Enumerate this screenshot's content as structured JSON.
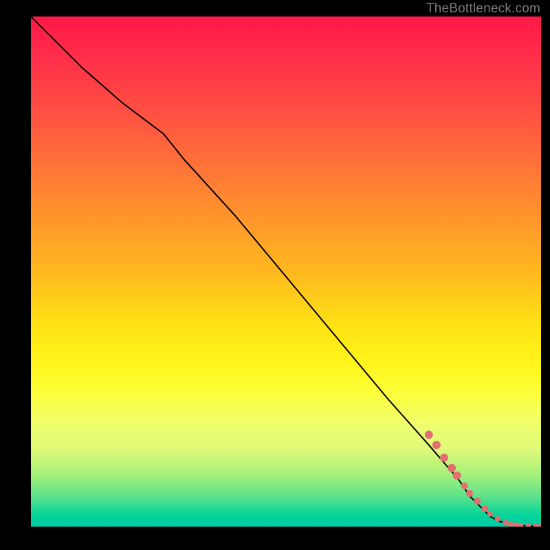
{
  "watermark": "TheBottleneck.com",
  "chart_data": {
    "type": "line",
    "title": "",
    "xlabel": "",
    "ylabel": "",
    "xlim": [
      0,
      100
    ],
    "ylim": [
      0,
      100
    ],
    "gradient_stops": [
      {
        "pos": 0,
        "color": "#ff1846"
      },
      {
        "pos": 8,
        "color": "#ff2e4a"
      },
      {
        "pos": 22,
        "color": "#ff5a3f"
      },
      {
        "pos": 36,
        "color": "#ff8a30"
      },
      {
        "pos": 50,
        "color": "#ffb81f"
      },
      {
        "pos": 60,
        "color": "#ffe015"
      },
      {
        "pos": 68,
        "color": "#fff51a"
      },
      {
        "pos": 74,
        "color": "#fbff3b"
      },
      {
        "pos": 80,
        "color": "#f0ff6e"
      },
      {
        "pos": 85,
        "color": "#def97a"
      },
      {
        "pos": 90,
        "color": "#a3f07a"
      },
      {
        "pos": 94,
        "color": "#5fe28c"
      },
      {
        "pos": 98,
        "color": "#00d49a"
      },
      {
        "pos": 100,
        "color": "#00c9a8"
      }
    ],
    "series": [
      {
        "name": "curve",
        "stroke": "#000000",
        "x": [
          0,
          10,
          18,
          26,
          30,
          40,
          50,
          60,
          70,
          78,
          84,
          86,
          88,
          90,
          92,
          94,
          96,
          98,
          100
        ],
        "y": [
          100,
          90,
          83,
          77,
          72,
          61,
          49,
          37,
          25,
          16,
          9,
          6,
          4,
          2,
          1,
          0.5,
          0.2,
          0.1,
          0.1
        ]
      }
    ],
    "markers": {
      "color": "#e27070",
      "points": [
        {
          "x": 78,
          "y": 18,
          "r": 6
        },
        {
          "x": 79.5,
          "y": 16,
          "r": 6
        },
        {
          "x": 81,
          "y": 13.5,
          "r": 6
        },
        {
          "x": 82.5,
          "y": 11.5,
          "r": 6
        },
        {
          "x": 83.5,
          "y": 10,
          "r": 6
        },
        {
          "x": 85,
          "y": 8,
          "r": 5
        },
        {
          "x": 86,
          "y": 6.5,
          "r": 5
        },
        {
          "x": 87.5,
          "y": 5,
          "r": 5
        },
        {
          "x": 89,
          "y": 3.5,
          "r": 5
        },
        {
          "x": 90,
          "y": 2.5,
          "r": 4
        },
        {
          "x": 91.5,
          "y": 1.5,
          "r": 4
        },
        {
          "x": 93,
          "y": 0.8,
          "r": 4
        },
        {
          "x": 94,
          "y": 0.5,
          "r": 4
        },
        {
          "x": 95,
          "y": 0.3,
          "r": 4
        },
        {
          "x": 96,
          "y": 0.2,
          "r": 4
        },
        {
          "x": 97.5,
          "y": 0.15,
          "r": 4
        },
        {
          "x": 99,
          "y": 0.1,
          "r": 4
        },
        {
          "x": 100,
          "y": 0.1,
          "r": 4
        }
      ]
    }
  }
}
